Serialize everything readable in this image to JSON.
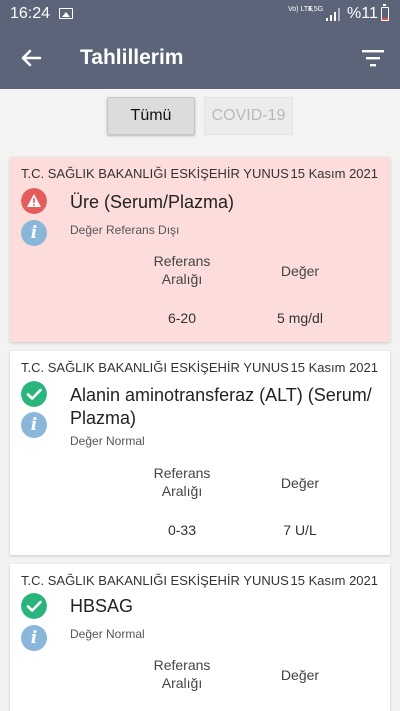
{
  "status_bar": {
    "time": "16:24",
    "lte": "Vo) LTE",
    "network": "4,5G",
    "battery": "%11"
  },
  "app_bar": {
    "title": "Tahlillerim",
    "back_icon": "arrow-left-icon",
    "filter_icon": "filter-icon"
  },
  "tabs": [
    {
      "label": "Tümü",
      "active": true
    },
    {
      "label": "COVID-19",
      "active": false
    }
  ],
  "colors": {
    "app_bar": "#5b6478",
    "alert_card": "#fddcdc",
    "normal_icon": "#2ab57d",
    "warning_icon": "#e45c5c",
    "info_icon": "#8ab6da"
  },
  "results": [
    {
      "hospital": "T.C. SAĞLIK BAKANLIĞI ESKİŞEHİR YUNUS",
      "date": "15 Kasım 2021",
      "test_name": "Üre (Serum/Plazma)",
      "status": "Değer Referans Dışı",
      "status_icon": "warning-icon",
      "reference_label": "Referans Aralığı",
      "value_label": "Değer",
      "reference_range": "6-20",
      "value": "5 mg/dl"
    },
    {
      "hospital": "T.C. SAĞLIK BAKANLIĞI ESKİŞEHİR YUNUS",
      "date": "15 Kasım 2021",
      "test_name": "Alanin aminotransferaz (ALT) (Serum/ Plazma)",
      "status": "Değer Normal",
      "status_icon": "check-icon",
      "reference_label": "Referans Aralığı",
      "value_label": "Değer",
      "reference_range": "0-33",
      "value": "7 U/L"
    },
    {
      "hospital": "T.C. SAĞLIK BAKANLIĞI ESKİŞEHİR YUNUS",
      "date": "15 Kasım 2021",
      "test_name": "HBSAG",
      "status": "Değer Normal",
      "status_icon": "check-icon",
      "reference_label": "Referans Aralığı",
      "value_label": "Değer"
    }
  ]
}
